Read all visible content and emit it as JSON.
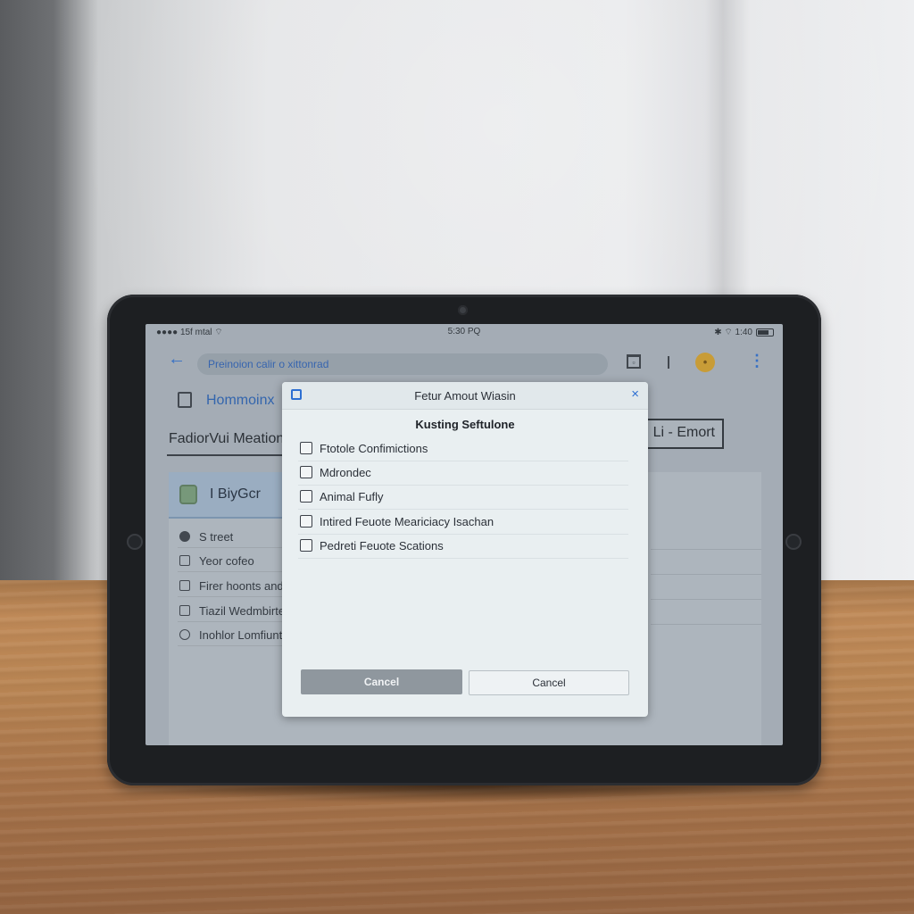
{
  "statusbar": {
    "left": "●●●● 15f mtal ⌔",
    "time": "5:30 PQ",
    "right": "✱ ⌔ 1:40"
  },
  "browser": {
    "url_text": "Preinoion calir o xittonrad"
  },
  "page": {
    "home_label": "Hommoinx",
    "banner_left": "FadiorVui Meation",
    "banner_right": "Li - Emort",
    "card_title": "I BiyGcr",
    "card_items": [
      {
        "label": "S treet",
        "icon": "radio-dot-icon"
      },
      {
        "label": "Yeor cofeo",
        "icon": "checkbox-icon"
      },
      {
        "label": "Firer hoonts and",
        "icon": "checkbox-icon"
      },
      {
        "label": "Tiazil Wedmbirte",
        "icon": "checkbox-icon"
      },
      {
        "label": "Inohlor Lomfiunt",
        "icon": "circle-icon"
      }
    ]
  },
  "dialog": {
    "title": "Fetur Amout Wiasin",
    "heading": "Kusting Seftulone",
    "close_symbol": "×",
    "options": [
      {
        "label": "Ftotole Confimictions",
        "checked": false
      },
      {
        "label": "Mdrondec",
        "checked": false
      },
      {
        "label": "Animal Fufly",
        "checked": false
      },
      {
        "label": "Intired Feuote Meariciacy Isachan",
        "checked": false
      },
      {
        "label": "Pedreti Feuote Scations",
        "checked": false
      }
    ],
    "primary_button": "Cancel",
    "secondary_button": "Cancel"
  },
  "colors": {
    "accent": "#2d6fd2",
    "profile": "#d9a32b",
    "dialog_bg": "#e9eff1"
  }
}
